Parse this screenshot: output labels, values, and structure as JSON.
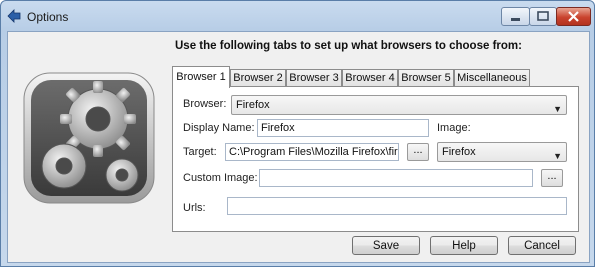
{
  "window": {
    "title": "Options"
  },
  "header": {
    "instruction": "Use the following tabs to set up what browsers to choose from:"
  },
  "tabs": [
    {
      "label": "Browser 1",
      "active": true
    },
    {
      "label": "Browser 2"
    },
    {
      "label": "Browser 3"
    },
    {
      "label": "Browser 4"
    },
    {
      "label": "Browser 5"
    },
    {
      "label": "Miscellaneous"
    }
  ],
  "form": {
    "browser_label": "Browser:",
    "browser_value": "Firefox",
    "display_name_label": "Display Name:",
    "display_name_value": "Firefox",
    "image_label": "Image:",
    "target_label": "Target:",
    "target_value": "C:\\Program Files\\Mozilla Firefox\\firefox.exe",
    "target_browse": "...",
    "image_value": "Firefox",
    "custom_image_label": "Custom Image:",
    "custom_image_value": "",
    "custom_image_browse": "...",
    "urls_label": "Urls:",
    "urls_value": ""
  },
  "buttons": {
    "save": "Save",
    "help": "Help",
    "cancel": "Cancel"
  },
  "icons": {
    "app": "arrow-icon",
    "logo": "gears-icon"
  }
}
